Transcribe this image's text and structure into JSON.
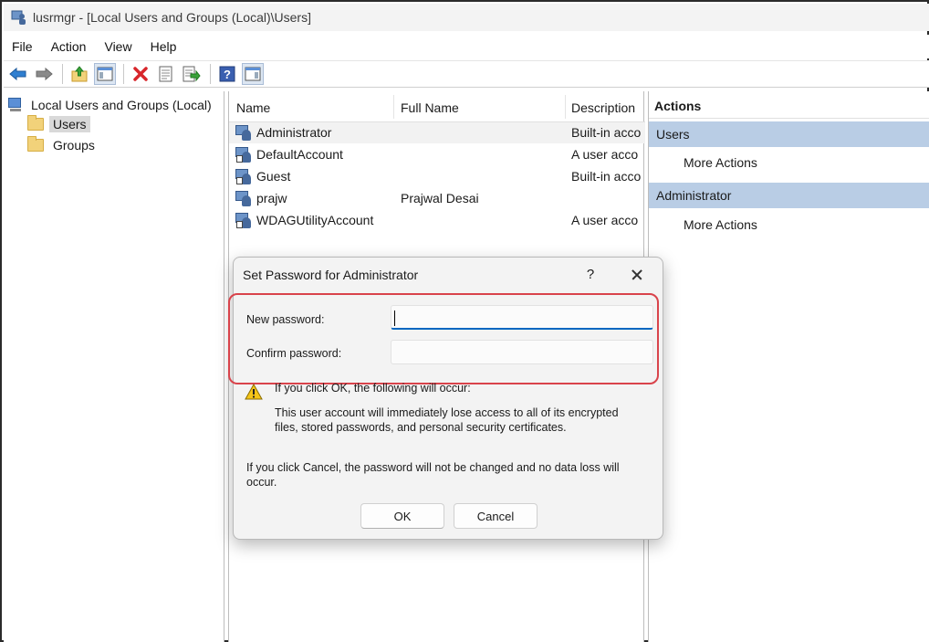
{
  "window": {
    "title": "lusrmgr - [Local Users and Groups (Local)\\Users]",
    "icon": "computer-users-icon"
  },
  "menu": [
    "File",
    "Action",
    "View",
    "Help"
  ],
  "toolbar": {
    "icons": [
      "back-arrow-icon",
      "forward-arrow-icon",
      "up-folder-icon",
      "show-hide-console-tree-icon",
      "delete-icon",
      "properties-icon",
      "export-list-icon",
      "help-icon",
      "show-hide-action-pane-icon"
    ]
  },
  "tree": {
    "root": "Local Users and Groups (Local)",
    "children": [
      {
        "label": "Users",
        "selected": true
      },
      {
        "label": "Groups",
        "selected": false
      }
    ]
  },
  "list": {
    "columns": [
      "Name",
      "Full Name",
      "Description"
    ],
    "rows": [
      {
        "name": "Administrator",
        "full_name": "",
        "description": "Built-in acco",
        "selected": true
      },
      {
        "name": "DefaultAccount",
        "full_name": "",
        "description": "A user acco"
      },
      {
        "name": "Guest",
        "full_name": "",
        "description": "Built-in acco"
      },
      {
        "name": "prajw",
        "full_name": "Prajwal Desai",
        "description": ""
      },
      {
        "name": "WDAGUtilityAccount",
        "full_name": "",
        "description": "A user acco"
      }
    ]
  },
  "actions": {
    "header": "Actions",
    "groups": [
      {
        "title": "Users",
        "items": [
          "More Actions"
        ]
      },
      {
        "title": "Administrator",
        "items": [
          "More Actions"
        ]
      }
    ]
  },
  "dialog": {
    "title": "Set Password for Administrator",
    "help": "?",
    "new_password_label": "New password:",
    "confirm_password_label": "Confirm password:",
    "new_password_value": "",
    "confirm_password_value": "",
    "warning_heading": "If you click OK, the following will occur:",
    "warning_body_1": "This user account will immediately lose access to all of its encrypted",
    "warning_body_2": "files, stored passwords, and personal security certificates.",
    "cancel_info_1": "If you click Cancel, the password will not be changed and no data loss will",
    "cancel_info_2": "occur.",
    "ok_label": "OK",
    "cancel_label": "Cancel",
    "highlight_color": "#d9434b"
  }
}
